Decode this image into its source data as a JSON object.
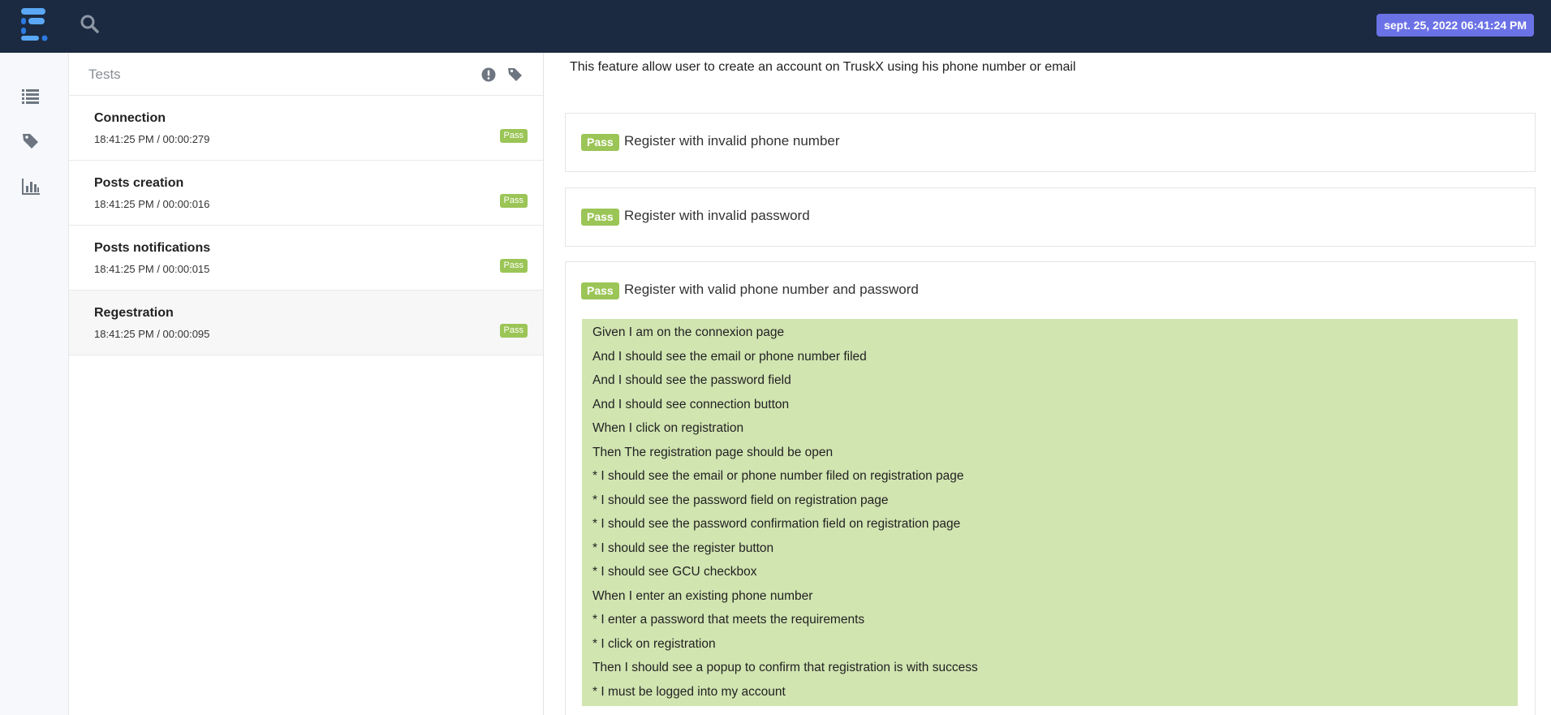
{
  "header": {
    "date_badge": "sept. 25, 2022 06:41:24 PM"
  },
  "sidebar": {
    "icons": [
      "list-icon",
      "tag-icon",
      "bar-chart-icon"
    ]
  },
  "tests_panel": {
    "title": "Tests",
    "items": [
      {
        "name": "Connection",
        "time": "18:41:25 PM / 00:00:279",
        "status": "Pass"
      },
      {
        "name": "Posts creation",
        "time": "18:41:25 PM / 00:00:016",
        "status": "Pass"
      },
      {
        "name": "Posts notifications",
        "time": "18:41:25 PM / 00:00:015",
        "status": "Pass"
      },
      {
        "name": "Regestration",
        "time": "18:41:25 PM / 00:00:095",
        "status": "Pass"
      }
    ]
  },
  "content": {
    "description": "This feature allow user to create an account on TruskX using his phone number or email",
    "scenarios": [
      {
        "status": "Pass",
        "title": "Register with invalid phone number"
      },
      {
        "status": "Pass",
        "title": "Register with invalid password"
      },
      {
        "status": "Pass",
        "title": "Register with valid phone number and password"
      }
    ],
    "steps": [
      "Given I am on the connexion page",
      "And I should see the email or phone number filed",
      "And I should see the password field",
      "And I should see connection button",
      "When I click on registration",
      "Then The registration page should be open",
      "* I should see the email or phone number filed on registration page",
      "* I should see the password field on registration page",
      "* I should see the password confirmation field on registration page",
      "* I should see the register button",
      "* I should see GCU checkbox",
      "When I enter an existing phone number",
      "* I enter a password that meets the requirements",
      "* I click on registration",
      "Then I should see a popup to confirm that registration is with success",
      "* I must be logged into my account"
    ]
  },
  "colors": {
    "topbar": "#1b2a40",
    "date_badge": "#6b72e6",
    "pass": "#9bc556",
    "steps_bg": "#d1e5b1"
  }
}
